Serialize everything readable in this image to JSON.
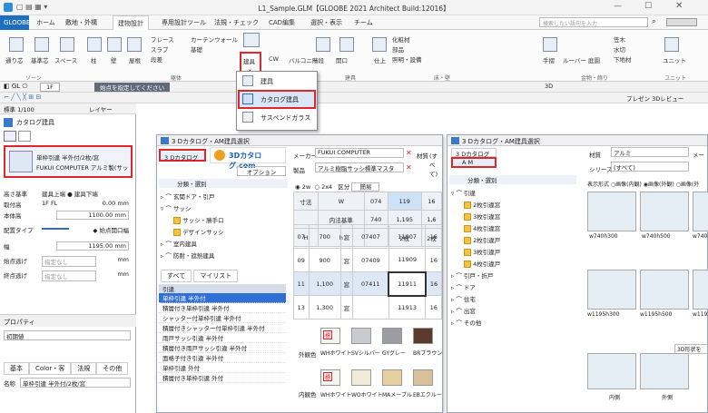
{
  "app": {
    "title": "L1_Sample.GLM【GLOOBE 2021 Architect Build:12016】",
    "search_placeholder": "検索したい語句を入力"
  },
  "menu": [
    "GLOOBE",
    "ホーム",
    "敷地・外構",
    "建物設計",
    "専用設計ツール",
    "法規・チェック",
    "CAD編集",
    "選択・表示",
    "チーム"
  ],
  "ribbon": {
    "items": [
      "通り芯",
      "基準芯",
      "スペース",
      "柱",
      "壁",
      "屋根",
      "フレース",
      "スラブ",
      "段差",
      "カーテンウォール",
      "基礎",
      "建具",
      "CW",
      "バルコニー",
      "階段",
      "開口",
      "仕上",
      "化粧材",
      "部品",
      "照明・設備",
      "手摺",
      "ルーバー",
      "庭園",
      "笠木",
      "水切",
      "下地材",
      "ユニット"
    ],
    "groups": [
      "ゾーン",
      "躯体",
      "建具",
      "床・壁",
      "金物・飾り",
      "ユニット"
    ]
  },
  "dropdown": {
    "items": [
      "建具",
      "カタログ建具",
      "サスペンドガラス"
    ]
  },
  "toolbar": {
    "floor": "1F",
    "hint": "始点を指定してください",
    "scale": "標準 1/100",
    "layer": "レイヤー",
    "three_d": "3D",
    "preview": "プレゼン 3Dレビュー"
  },
  "left_panel": {
    "title": "カタログ建具",
    "selected_line1": "単枠引違 半外付/2枚/窓",
    "selected_line2": "FUKUI COMPUTER アルミ製(サッ",
    "rows": [
      {
        "label": "高さ基準",
        "value": "建具上端 ● 建具下端"
      },
      {
        "label": "取付高",
        "value": "1F  FL",
        "unit": "0.00 mm"
      },
      {
        "label": "本体高",
        "value": "",
        "unit": "1100.00 mm"
      },
      {
        "label": "配置タイプ",
        "value": "",
        "unit": "◆ 始点開口幅"
      },
      {
        "label": "幅",
        "value": "",
        "unit": "1195.00 mm"
      },
      {
        "label": "始点逃げ",
        "value": "指定なし",
        "unit": "mm"
      },
      {
        "label": "終点逃げ",
        "value": "指定なし",
        "unit": "mm"
      }
    ],
    "props_title": "プロパティ",
    "props_value": "初期値",
    "tabs": [
      "基本",
      "Color・客",
      "法規",
      "その他"
    ],
    "name_label": "名称",
    "name_value": "単枠引違 半外付/2枚/窓"
  },
  "dlg1": {
    "title": "3 Dカタログ・AM建具選択",
    "tab": "3 Dカタログ",
    "logo": "3Dカタログ.com",
    "option": "オプション",
    "class_title": "分類・選別",
    "tree": [
      "玄関ドア・引戸",
      "サッシ",
      "サッシ・勝手口",
      "デザインサッシ",
      "室内建具",
      "防耐・遮熱建具"
    ],
    "list_tabs": [
      "すべて",
      "マイリスト"
    ],
    "list_header": "引違",
    "list": [
      "単枠引違 半外付",
      "積層付き単枠引違 半外付",
      "シャッター付単枠引違 半外付",
      "積層付きシャッター付単枠引違 半外付",
      "雨戸サッシ引違 半外付",
      "積層付き雨戸サッシ引違 半外付",
      "面格子付き引違 半外付",
      "単枠引違 外付",
      "積層付き単枠引違 外付"
    ],
    "maker_label": "メーカー",
    "maker": "FUKUI COMPUTER",
    "product_label": "製品",
    "product": "アルミ樹脂サッシ標準マスタ",
    "material_label": "材質",
    "material": "(すべて)",
    "filters": [
      "2w",
      "2x4",
      "区分",
      "簡易"
    ],
    "table_head": [
      [
        "寸法",
        "W",
        "074",
        "119",
        "16"
      ],
      [
        "",
        "内法基準",
        "740",
        "1,195",
        "1,6"
      ],
      [
        "H",
        "h",
        "",
        "2枚",
        "2枚"
      ]
    ],
    "table": [
      [
        "07",
        "700",
        "窓",
        "07407",
        "11907",
        "16"
      ],
      [
        "09",
        "900",
        "窓",
        "07409",
        "11909",
        "16"
      ],
      [
        "11",
        "1,100",
        "窓",
        "07411",
        "11911",
        "16"
      ],
      [
        "13",
        "1,300",
        "窓",
        "",
        "11913",
        "16"
      ]
    ],
    "ext_label": "外観色",
    "int_label": "内観色",
    "ext_colors": [
      {
        "name": "WHホワイト",
        "c": "#f4f4f0"
      },
      {
        "name": "SVシルバー",
        "c": "#c8ccd0"
      },
      {
        "name": "GYグレー",
        "c": "#9a9ea2"
      },
      {
        "name": "BRブラウン",
        "c": "#5a3a2a"
      }
    ],
    "int_colors": [
      {
        "name": "WHホワイト",
        "c": "#f4f4f0"
      },
      {
        "name": "WOホワイト",
        "c": "#f1ead8"
      },
      {
        "name": "MAメープル",
        "c": "#e8cfa2"
      },
      {
        "name": "EBエクルー",
        "c": "#d9c09a"
      }
    ],
    "std_mark": "標"
  },
  "dlg2": {
    "title": "3 Dカタログ・AM建具選択",
    "tabs": [
      "3 Dカタログ",
      "A M"
    ],
    "class_title": "分類・選別",
    "material_label": "材質",
    "material": "アルミ",
    "series_label": "シリーズ",
    "series": "(すべて)",
    "maker_label": "メー",
    "tree": [
      "引違",
      "2枚引違窓",
      "3枚引違窓",
      "4枚引違窓",
      "2枚引違戸",
      "3枚引違戸",
      "4枚引違戸",
      "引戸・折戸",
      "ドア",
      "住宅",
      "出窓",
      "その他"
    ],
    "display_label": "表示形式",
    "display_opts": [
      "画像(内観)",
      "画像(外観)",
      "画像(外"
    ],
    "thumbs": [
      "w740h300",
      "w740h500",
      "w740h700",
      "w1195h300",
      "w1195h500",
      "w1195h7"
    ],
    "btn_3d": "3D形状を",
    "bottom": [
      "内側",
      "外側"
    ]
  }
}
